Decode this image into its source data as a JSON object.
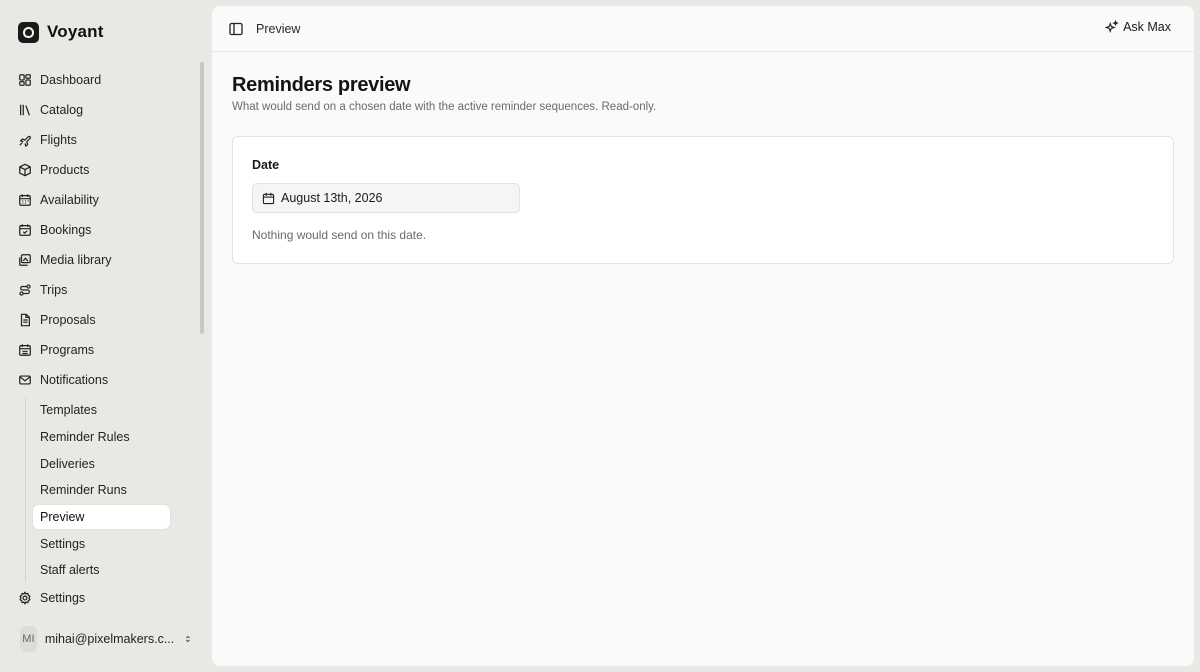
{
  "brand": {
    "name": "Voyant"
  },
  "sidebar": {
    "items": [
      {
        "label": "Dashboard",
        "icon": "dashboard-icon"
      },
      {
        "label": "Catalog",
        "icon": "library-icon"
      },
      {
        "label": "Flights",
        "icon": "plane-icon"
      },
      {
        "label": "Products",
        "icon": "package-icon"
      },
      {
        "label": "Availability",
        "icon": "calendar-grid-icon"
      },
      {
        "label": "Bookings",
        "icon": "calendar-check-icon"
      },
      {
        "label": "Media library",
        "icon": "images-icon"
      },
      {
        "label": "Trips",
        "icon": "route-icon"
      },
      {
        "label": "Proposals",
        "icon": "file-text-icon"
      },
      {
        "label": "Programs",
        "icon": "calendar-list-icon"
      },
      {
        "label": "Notifications",
        "icon": "mail-icon"
      }
    ],
    "notification_subitems": [
      {
        "label": "Templates"
      },
      {
        "label": "Reminder Rules"
      },
      {
        "label": "Deliveries"
      },
      {
        "label": "Reminder Runs"
      },
      {
        "label": "Preview",
        "active": true
      },
      {
        "label": "Settings"
      },
      {
        "label": "Staff alerts"
      }
    ],
    "settings": {
      "label": "Settings",
      "icon": "gear-icon"
    },
    "user": {
      "initials": "MI",
      "email": "mihai@pixelmakers.c..."
    }
  },
  "topbar": {
    "breadcrumb": "Preview",
    "ask_label": "Ask Max"
  },
  "page": {
    "title": "Reminders preview",
    "subtitle": "What would send on a chosen date with the active reminder sequences. Read-only.",
    "date_label": "Date",
    "date_value": "August 13th, 2026",
    "empty_message": "Nothing would send on this date."
  }
}
